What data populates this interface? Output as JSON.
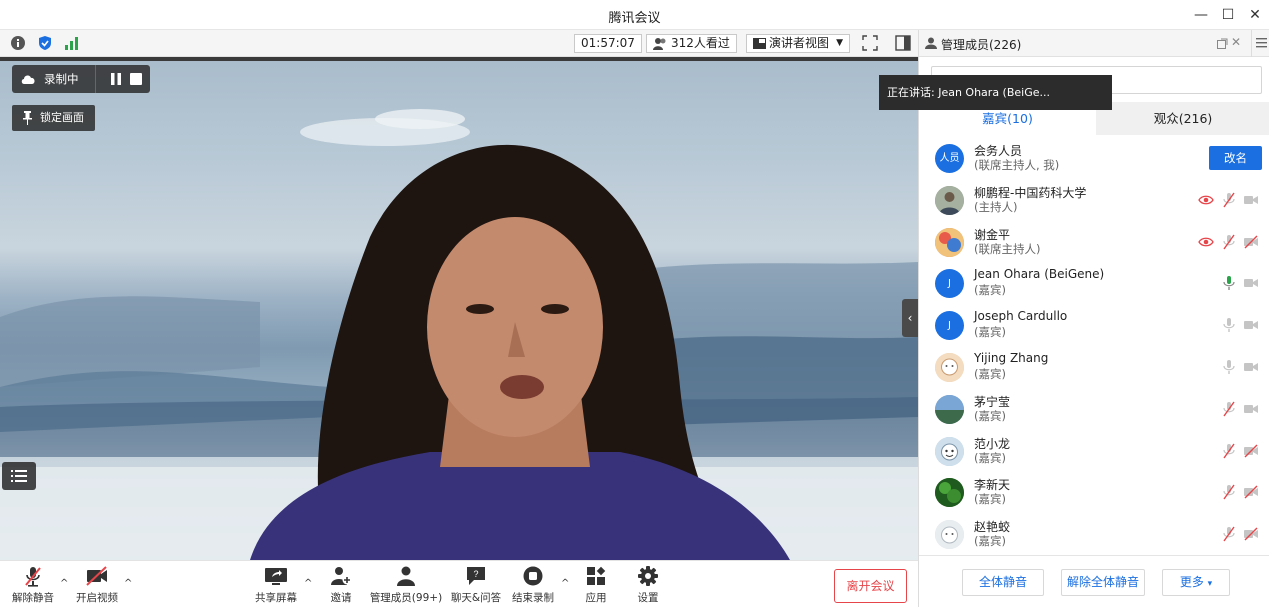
{
  "window": {
    "title": "腾讯会议"
  },
  "toolbar": {
    "timer": "01:57:07",
    "viewers": "312人看过",
    "view_mode": "演讲者视图"
  },
  "video": {
    "recording_label": "录制中",
    "lock_label": "锁定画面",
    "speaking_tooltip": "正在讲话: Jean Ohara (BeiGe..."
  },
  "bottom": {
    "unmute": "解除静音",
    "video": "开启视频",
    "share": "共享屏幕",
    "invite": "邀请",
    "members": "管理成员(99+)",
    "chat": "聊天&问答",
    "end_record": "结束录制",
    "apps": "应用",
    "settings": "设置",
    "leave": "离开会议"
  },
  "panel": {
    "title": "管理成员(226)",
    "tab_guests": "嘉宾(10)",
    "tab_audience": "观众(216)",
    "rename": "改名",
    "members": [
      {
        "name": "会务人员",
        "role": "(联席主持人, 我)",
        "avatar_text": "人员",
        "avatar_color": "#1b6fe0"
      },
      {
        "name": "柳鹏程-中国药科大学",
        "role": "(主持人)",
        "avatar_text": "",
        "avatar_color": "#7c8a78"
      },
      {
        "name": "谢金平",
        "role": "(联席主持人)",
        "avatar_text": "",
        "avatar_color": "#d47a4a"
      },
      {
        "name": "Jean Ohara (BeiGene)",
        "role": "(嘉宾)",
        "avatar_text": "J",
        "avatar_color": "#1b6fe0"
      },
      {
        "name": "Joseph Cardullo",
        "role": "(嘉宾)",
        "avatar_text": "J",
        "avatar_color": "#1b6fe0"
      },
      {
        "name": "Yijing Zhang",
        "role": "(嘉宾)",
        "avatar_text": "",
        "avatar_color": "#e7c9a6"
      },
      {
        "name": "茅宁莹",
        "role": "(嘉宾)",
        "avatar_text": "",
        "avatar_color": "#5f87b5"
      },
      {
        "name": "范小龙",
        "role": "(嘉宾)",
        "avatar_text": "",
        "avatar_color": "#9bbbd3"
      },
      {
        "name": "李新天",
        "role": "(嘉宾)",
        "avatar_text": "",
        "avatar_color": "#2f7a2a"
      },
      {
        "name": "赵艳蛟",
        "role": "(嘉宾)",
        "avatar_text": "",
        "avatar_color": "#cfd7de"
      }
    ],
    "mute_all": "全体静音",
    "unmute_all": "解除全体静音",
    "more": "更多"
  }
}
